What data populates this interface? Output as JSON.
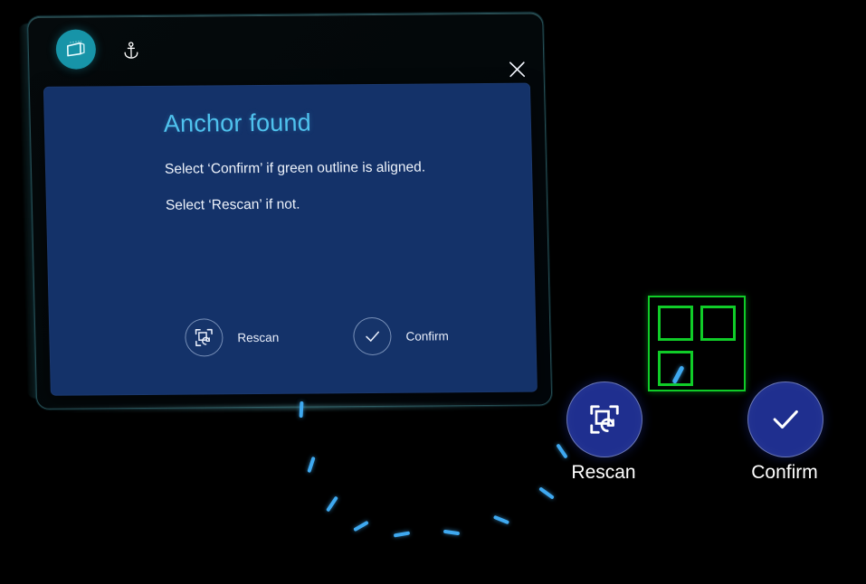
{
  "app": {
    "badge_icon": "slate-window-icon",
    "anchor_icon": "anchor-icon",
    "close_icon": "close-icon",
    "accent_teal": "#1794a8",
    "panel_blue": "#143269",
    "button_blue": "#1f2f8f",
    "marker_green": "#10cc28",
    "title_cyan": "#4fc2ee",
    "dash_blue": "#3fa9f0"
  },
  "dialog": {
    "title": "Anchor found",
    "line1": "Select ‘Confirm’ if green outline is aligned.",
    "line2": "Select ‘Rescan’ if not.",
    "buttons": [
      {
        "label": "Rescan",
        "icon": "rescan-icon"
      },
      {
        "label": "Confirm",
        "icon": "check-icon"
      }
    ]
  },
  "far_buttons": [
    {
      "label": "Rescan",
      "icon": "rescan-icon"
    },
    {
      "label": "Confirm",
      "icon": "check-icon"
    }
  ],
  "marker": {
    "name": "anchor-marker-outline",
    "corner_squares": 3
  }
}
